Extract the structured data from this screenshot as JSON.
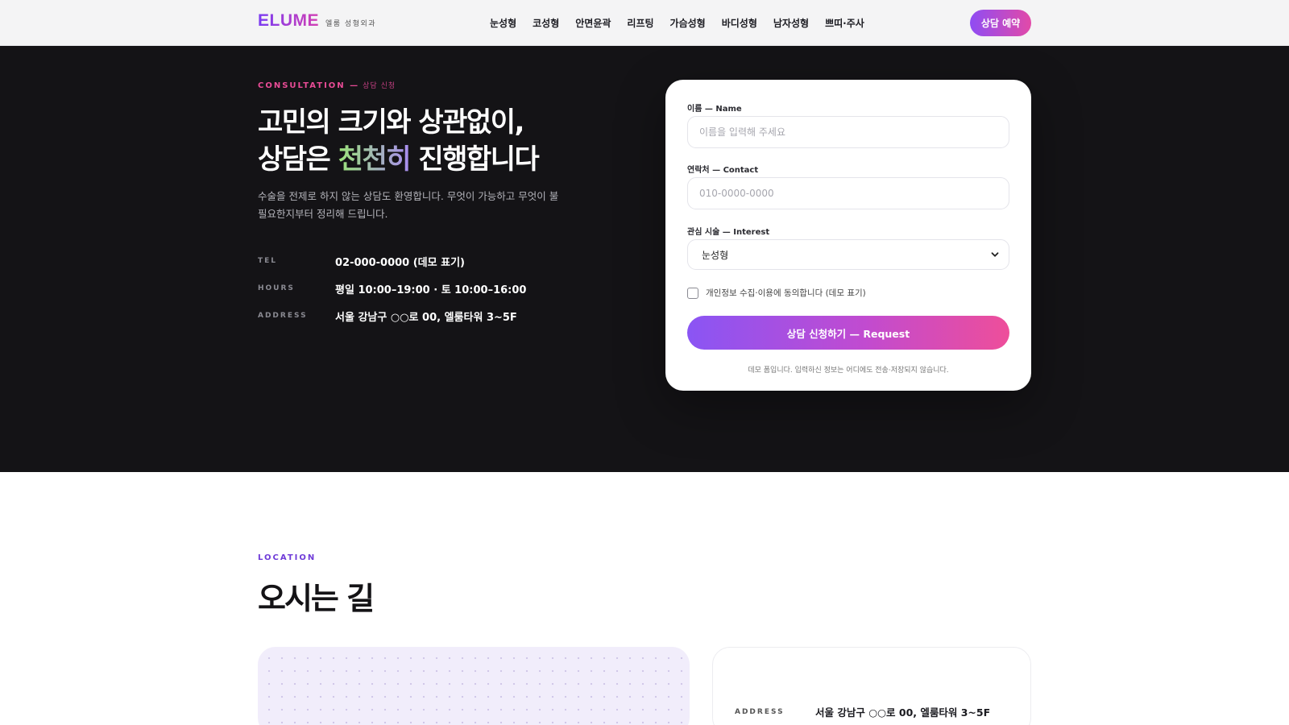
{
  "header": {
    "logo": "ELUME",
    "logo_sub": "엘룸 성형외과",
    "nav": [
      "눈성형",
      "코성형",
      "안면윤곽",
      "리프팅",
      "가슴성형",
      "바디성형",
      "남자성형",
      "쁘띠·주사"
    ],
    "cta": "상담 예약"
  },
  "hero": {
    "eyebrow": "CONSULTATION —",
    "eyebrow_ko": "상담 신청",
    "title_line1": "고민의 크기와 상관없이,",
    "title_line2_pre": "상담은 ",
    "title_line2_hl": "천천히",
    "title_line2_post": " 진행합니다",
    "description": "수술을 전제로 하지 않는 상담도 환영합니다. 무엇이 가능하고 무엇이 불필요한지부터 정리해 드립니다.",
    "info": [
      {
        "key": "TEL",
        "value": "02-000-0000 (데모 표기)"
      },
      {
        "key": "HOURS",
        "value": "평일 10:00–19:00 · 토 10:00–16:00"
      },
      {
        "key": "ADDRESS",
        "value": "서울 강남구 ○○로 00, 엘룸타워 3~5F"
      }
    ]
  },
  "form": {
    "name_label": "이름 — Name",
    "name_placeholder": "이름을 입력해 주세요",
    "contact_label": "연락처 — Contact",
    "contact_placeholder": "010-0000-0000",
    "interest_label": "관심 시술 — Interest",
    "interest_value": "눈성형",
    "consent_text": "개인정보 수집·이용에 동의합니다 (데모 표기)",
    "consent_checked": false,
    "submit_label": "상담 신청하기 — Request",
    "note": "데모 폼입니다. 입력하신 정보는 어디에도 전송·저장되지 않습니다."
  },
  "location": {
    "eyebrow": "LOCATION",
    "title": "오시는 길",
    "address_key": "ADDRESS",
    "address_value": "서울 강남구 ○○로 00, 엘룸타워 3~5F"
  },
  "colors": {
    "accent_purple": "#8f4cf3",
    "accent_pink": "#e24aa8",
    "hero_bg": "#141316"
  },
  "icons": {
    "select_chevron": "chevron-down-icon"
  }
}
